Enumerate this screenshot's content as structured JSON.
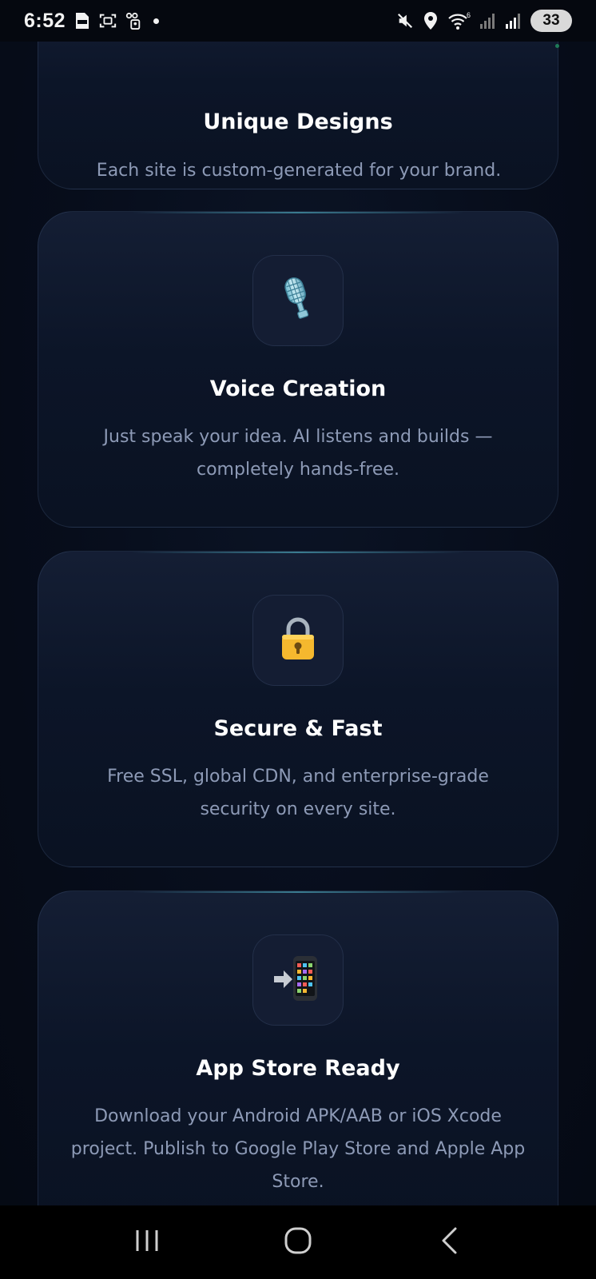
{
  "status_bar": {
    "time": "6:52",
    "battery": "33",
    "network_superscript": "6",
    "left_icons": [
      "pdf-icon",
      "screenshot-icon",
      "accessibility-icon",
      "notification-dot-icon"
    ],
    "right_icons": [
      "mute-icon",
      "location-icon",
      "wifi-icon",
      "signal-icon",
      "signal-icon",
      "battery-icon"
    ]
  },
  "features": [
    {
      "title": "Unique Designs",
      "description": "Each site is custom-generated for your brand."
    },
    {
      "icon": "microphone-icon",
      "emoji": "🎙️",
      "title": "Voice Creation",
      "description": "Just speak your idea. AI listens and builds — completely hands-free."
    },
    {
      "icon": "lock-icon",
      "emoji": "🔒",
      "title": "Secure & Fast",
      "description": "Free SSL, global CDN, and enterprise-grade security on every site."
    },
    {
      "icon": "mobile-arrow-icon",
      "emoji": "📲",
      "title": "App Store Ready",
      "description": "Download your Android APK/AAB or iOS Xcode project. Publish to Google Play Store and Apple App Store."
    }
  ],
  "nav_bar": {
    "buttons": [
      "recent-apps-icon",
      "home-icon",
      "back-icon"
    ]
  },
  "colors": {
    "background": "#060c18",
    "card": "#0c1528",
    "accent_glow": "#5ac8dc",
    "description_text": "#8d9ab6"
  }
}
